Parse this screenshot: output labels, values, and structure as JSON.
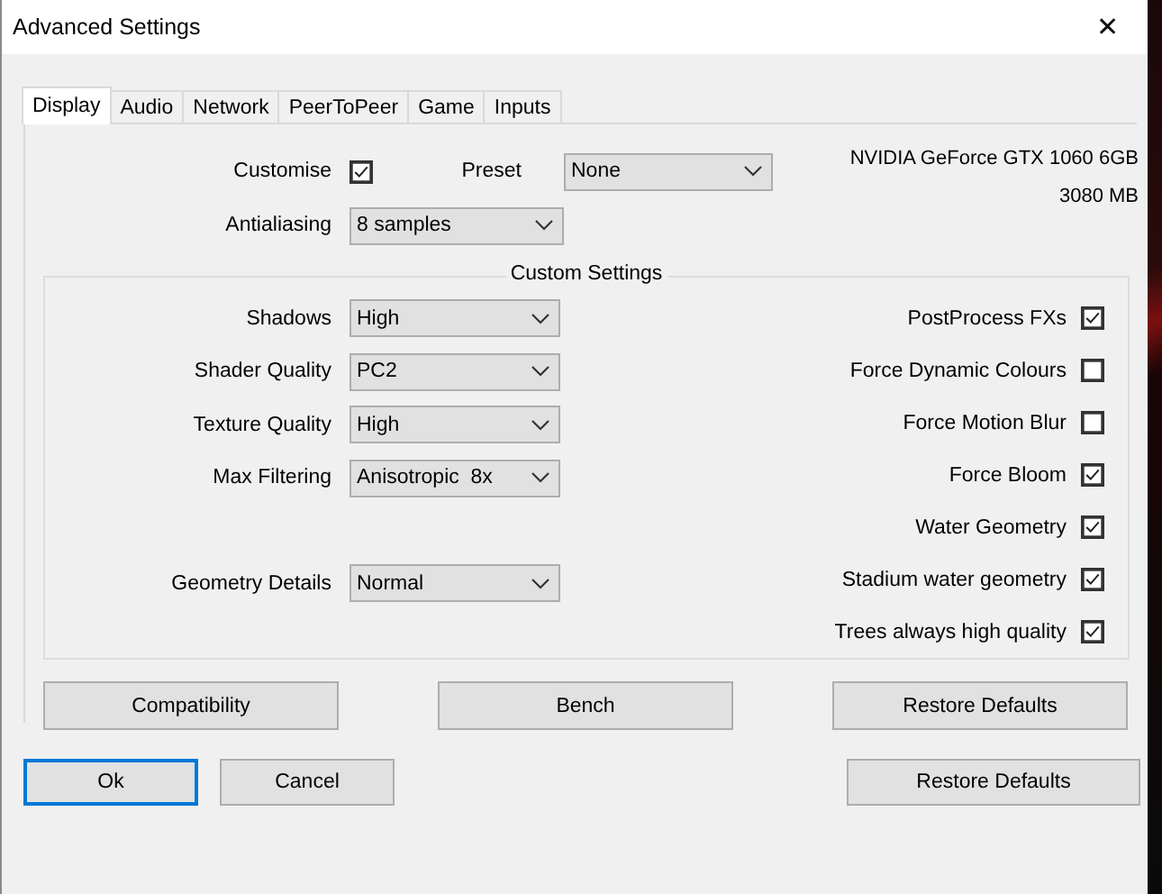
{
  "window": {
    "title": "Advanced Settings",
    "close": "✕"
  },
  "tabs": [
    {
      "label": "Display",
      "selected": true
    },
    {
      "label": "Audio",
      "selected": false
    },
    {
      "label": "Network",
      "selected": false
    },
    {
      "label": "PeerToPeer",
      "selected": false
    },
    {
      "label": "Game",
      "selected": false
    },
    {
      "label": "Inputs",
      "selected": false
    }
  ],
  "customise": {
    "label": "Customise",
    "checked": true
  },
  "preset": {
    "label": "Preset",
    "value": "None"
  },
  "antialiasing": {
    "label": "Antialiasing",
    "value": "8 samples"
  },
  "gpu": {
    "name": "NVIDIA GeForce GTX 1060 6GB",
    "memory": "3080 MB"
  },
  "custom_settings": {
    "title": "Custom Settings",
    "dropdowns": [
      {
        "label": "Shadows",
        "value": "High"
      },
      {
        "label": "Shader Quality",
        "value": "PC2"
      },
      {
        "label": "Texture Quality",
        "value": "High"
      },
      {
        "label": "Max Filtering",
        "value": "Anisotropic  8x"
      },
      {
        "label": "Geometry Details",
        "value": "Normal"
      }
    ],
    "toggles": [
      {
        "label": "PostProcess FXs",
        "checked": true
      },
      {
        "label": "Force Dynamic Colours",
        "checked": false
      },
      {
        "label": "Force Motion Blur",
        "checked": false
      },
      {
        "label": "Force Bloom",
        "checked": true
      },
      {
        "label": "Water Geometry",
        "checked": true
      },
      {
        "label": "Stadium water geometry",
        "checked": true
      },
      {
        "label": "Trees always high quality",
        "checked": true
      }
    ]
  },
  "panel_buttons": [
    "Compatibility",
    "Bench",
    "Restore Defaults"
  ],
  "dialog_buttons": [
    {
      "label": "Ok",
      "focused": true
    },
    {
      "label": "Cancel",
      "focused": false
    },
    {
      "label": "Restore Defaults",
      "focused": false
    }
  ]
}
